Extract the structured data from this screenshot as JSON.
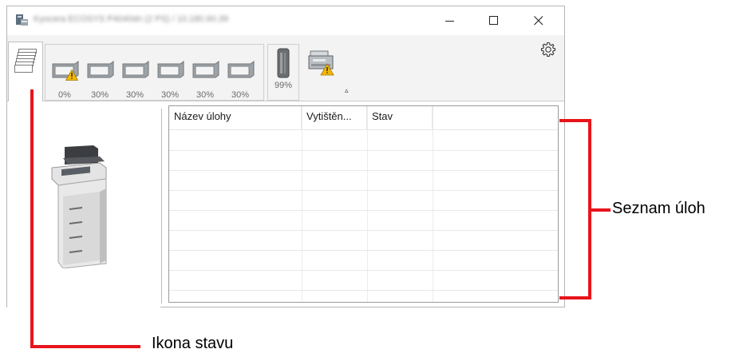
{
  "window": {
    "title": "Kyocera ECOSYS P4040dn (2 PS) / 10.180.60.39",
    "controls": {
      "minimize": "—",
      "maximize": "☐",
      "close": "✕"
    }
  },
  "toolbar": {
    "status_tab_icon": "document-stack-icon",
    "trays": [
      {
        "label": "0%",
        "warning": true
      },
      {
        "label": "30%",
        "warning": false
      },
      {
        "label": "30%",
        "warning": false
      },
      {
        "label": "30%",
        "warning": false
      },
      {
        "label": "30%",
        "warning": false
      },
      {
        "label": "30%",
        "warning": false
      }
    ],
    "toner": {
      "label": "99%"
    },
    "device_icon": "printer-warning-icon",
    "collapse_glyph": "▵",
    "settings_icon": "gear-icon"
  },
  "job_list": {
    "columns": [
      "Název úlohy",
      "Vytištěn...",
      "Stav",
      ""
    ],
    "rows": []
  },
  "callouts": {
    "job_list": "Seznam úloh",
    "status_icon": "Ikona stavu"
  },
  "colors": {
    "callout": "#e8141b",
    "warning": "#f2b705"
  }
}
